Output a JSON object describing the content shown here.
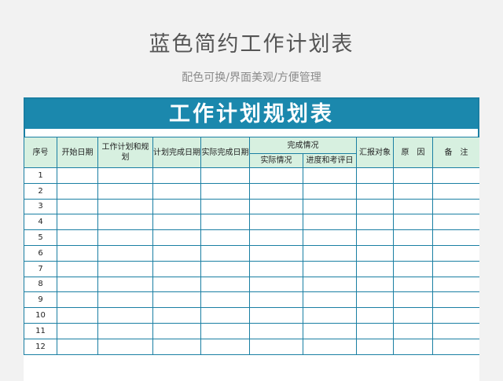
{
  "page": {
    "title": "蓝色简约工作计划表",
    "subtitle": "配色可换/界面美观/方便管理"
  },
  "sheet": {
    "banner_title": "工作计划规划表",
    "headers": {
      "seq": "序号",
      "start_date": "开始日期",
      "plan": "工作计划和规划",
      "plan_done_date": "计划完成日期",
      "actual_done_date": "实际完成日期",
      "completion": "完成情况",
      "actual_status": "实际情况",
      "progress_eval_date": "进度和考评日期",
      "report_to": "汇报对象",
      "reason": "原　因",
      "remark": "备　注"
    },
    "row_numbers": [
      "1",
      "2",
      "3",
      "4",
      "5",
      "6",
      "7",
      "8",
      "9",
      "10",
      "11",
      "12"
    ]
  },
  "colors": {
    "banner": "#1b88ad",
    "header_fill": "#d7f0e0",
    "border": "#1a7fa3",
    "background": "#f2f2f2"
  }
}
